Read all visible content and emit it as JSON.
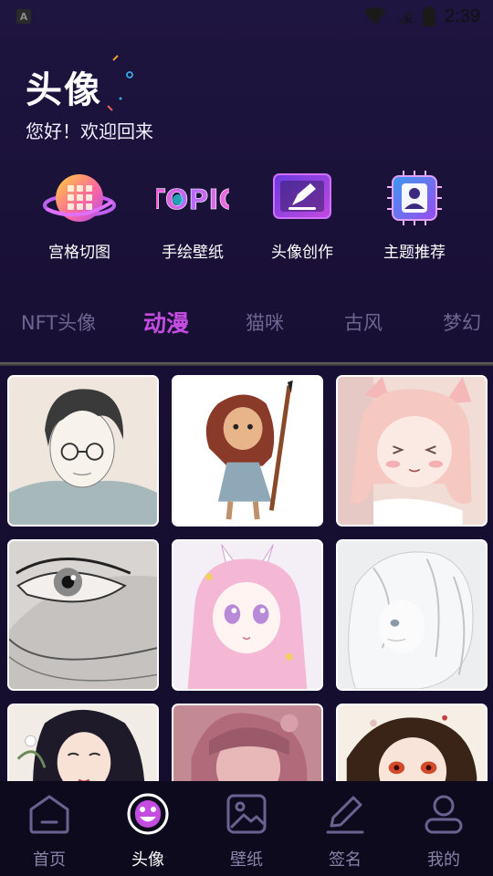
{
  "status_bar": {
    "time": "2:39"
  },
  "header": {
    "title": "头像",
    "subtitle": "您好！欢迎回来"
  },
  "actions": [
    {
      "label": "宫格切图",
      "icon": "grid-planet-icon"
    },
    {
      "label": "手绘壁纸",
      "icon": "topic-text-icon",
      "icon_text": "TOPIC"
    },
    {
      "label": "头像创作",
      "icon": "edit-pen-icon"
    },
    {
      "label": "主题推荐",
      "icon": "avatar-frame-icon"
    }
  ],
  "tabs": [
    {
      "label": "NFT头像",
      "active": false
    },
    {
      "label": "动漫",
      "active": true
    },
    {
      "label": "猫咪",
      "active": false
    },
    {
      "label": "古风",
      "active": false
    },
    {
      "label": "梦幻",
      "active": false
    }
  ],
  "grid": [
    {
      "name": "avatar-tile-boy-glasses"
    },
    {
      "name": "avatar-tile-girl-paintbrush"
    },
    {
      "name": "avatar-tile-pink-cat-girl"
    },
    {
      "name": "avatar-tile-eye-closeup"
    },
    {
      "name": "avatar-tile-pink-horned-girl"
    },
    {
      "name": "avatar-tile-white-hair-girl"
    },
    {
      "name": "avatar-tile-dark-hair-woman"
    },
    {
      "name": "avatar-tile-pink-girl"
    },
    {
      "name": "avatar-tile-red-eye-girl"
    }
  ],
  "bottom_nav": [
    {
      "label": "首页",
      "icon": "home-icon",
      "active": false
    },
    {
      "label": "头像",
      "icon": "smiley-icon",
      "active": true
    },
    {
      "label": "壁纸",
      "icon": "image-icon",
      "active": false
    },
    {
      "label": "签名",
      "icon": "pen-icon",
      "active": false
    },
    {
      "label": "我的",
      "icon": "user-icon",
      "active": false
    }
  ],
  "colors": {
    "background": "#180f34",
    "accent": "#c44ce0",
    "tab_inactive": "#6e6690",
    "nav_inactive": "#8a83aa"
  }
}
